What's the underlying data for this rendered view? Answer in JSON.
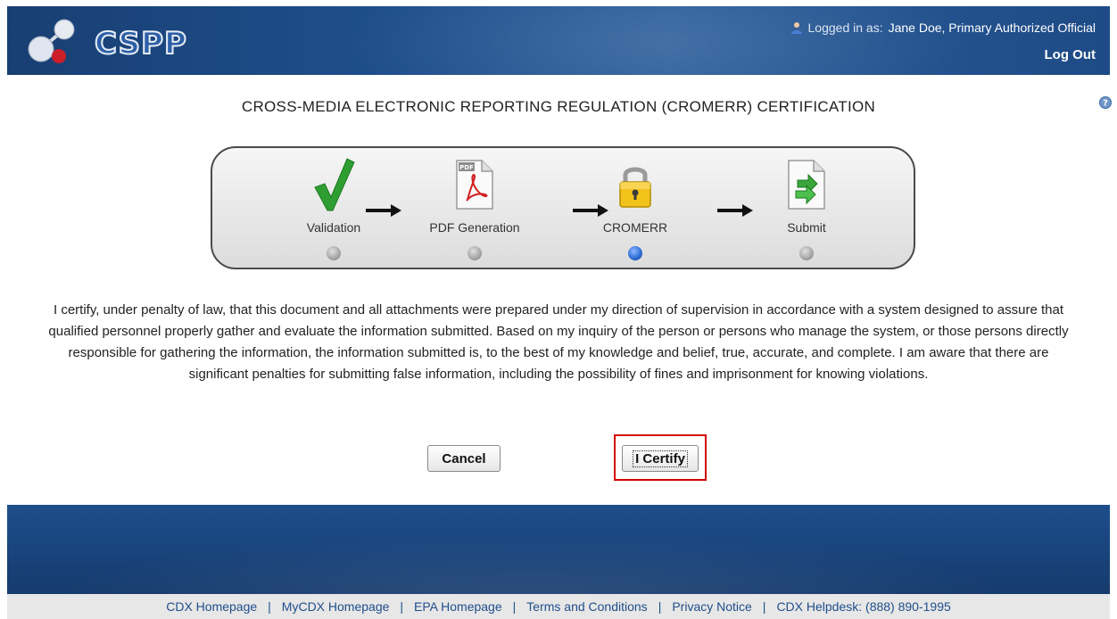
{
  "header": {
    "logo_text": "CSPP",
    "user_prefix": "Logged in as:",
    "user_name": "Jane Doe, Primary Authorized Official",
    "logout_label": "Log Out"
  },
  "page_title": "CROSS-MEDIA ELECTRONIC REPORTING REGULATION (CROMERR) CERTIFICATION",
  "progress": {
    "steps": [
      {
        "label": "Validation",
        "icon": "checkmark-icon",
        "active": false
      },
      {
        "label": "PDF Generation",
        "icon": "pdf-file-icon",
        "active": false
      },
      {
        "label": "CROMERR",
        "icon": "padlock-icon",
        "active": true
      },
      {
        "label": "Submit",
        "icon": "submit-document-icon",
        "active": false
      }
    ],
    "pdf_badge": "PDF"
  },
  "certification_text": "I certify, under penalty of law, that this document and all attachments were prepared under my direction of supervision in accordance with a system designed to assure that qualified personnel properly gather and evaluate the information submitted. Based on my inquiry of the person or persons who manage the system, or those persons directly responsible for gathering the information, the information submitted is, to the best of my knowledge and belief, true, accurate, and complete. I am aware that there are significant penalties for submitting false information, including the possibility of fines and imprisonment for knowing violations.",
  "buttons": {
    "cancel": "Cancel",
    "certify": "I Certify"
  },
  "footer": {
    "links": [
      "CDX Homepage",
      "MyCDX Homepage",
      "EPA Homepage",
      "Terms and Conditions",
      "Privacy Notice",
      "CDX Helpdesk: (888) 890-1995"
    ]
  },
  "colors": {
    "header_blue": "#1f4f8c",
    "highlight_red": "#d40000",
    "active_step_blue": "#2f6fd8"
  }
}
